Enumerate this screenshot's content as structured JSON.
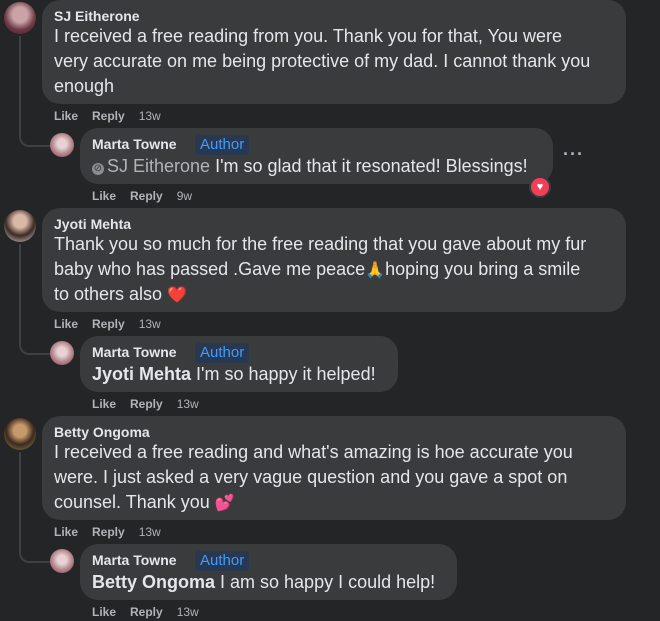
{
  "comments": [
    {
      "author": "SJ Eitherone",
      "text_lines": [
        "I received a free reading from you. Thank you for that, You were",
        "very accurate on me being protective of my dad. I cannot thank you",
        "enough"
      ],
      "actions": {
        "like": "Like",
        "reply": "Reply",
        "time": "13w"
      },
      "reply": {
        "author": "Marta Towne",
        "badge": "Author",
        "mention": "SJ Eitherone",
        "text": " I'm so glad that it resonated! Blessings!",
        "actions": {
          "like": "Like",
          "reply": "Reply",
          "time": "9w"
        },
        "reaction": "heart-reaction"
      }
    },
    {
      "author": "Jyoti Mehta",
      "text_lines": [
        "Thank you so much for the free reading that you gave about my fur",
        "baby who has passed .Gave me peace",
        "hoping you bring a smile",
        "to others also"
      ],
      "emoji": {
        "pray": "🙏",
        "heart": "❤️"
      },
      "actions": {
        "like": "Like",
        "reply": "Reply",
        "time": "13w"
      },
      "reply": {
        "author": "Marta Towne",
        "badge": "Author",
        "mention": "Jyoti Mehta",
        "text": " I'm so happy it helped!",
        "actions": {
          "like": "Like",
          "reply": "Reply",
          "time": "13w"
        }
      }
    },
    {
      "author": "Betty Ongoma",
      "text_lines": [
        "I received a free reading and what's amazing is hoe accurate you",
        "were. I just asked a very vague question and you gave a spot on",
        "counsel. Thank you"
      ],
      "emoji": {
        "hearts": "💕"
      },
      "actions": {
        "like": "Like",
        "reply": "Reply",
        "time": "13w"
      },
      "reply": {
        "author": "Marta Towne",
        "badge": "Author",
        "mention": "Betty Ongoma",
        "text": " I am so happy I could help!",
        "actions": {
          "like": "Like",
          "reply": "Reply",
          "time": "13w"
        }
      }
    }
  ],
  "more_icon": "more-options-icon",
  "colors": {
    "background": "#242526",
    "bubble": "#3a3b3c",
    "author_badge_bg": "#263951",
    "author_badge_text": "#4599ff",
    "reaction": "#f33e58"
  }
}
